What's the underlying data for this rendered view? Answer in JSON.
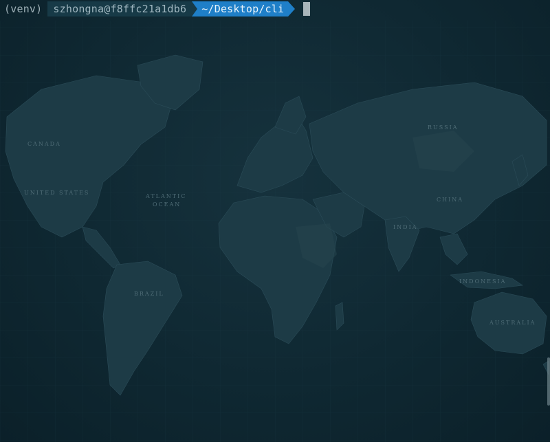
{
  "prompt": {
    "venv": "(venv)",
    "user_host": "szhongna@f8ffc21a1db6",
    "path": "~/Desktop/cli"
  },
  "map_labels": {
    "canada": "CANADA",
    "united_states": "UNITED STATES",
    "atlantic": "ATLANTIC",
    "ocean": "OCEAN",
    "russia": "RUSSIA",
    "china": "CHINA",
    "brazil": "BRAZIL",
    "australia": "AUSTRALIA",
    "indonesia": "INDONESIA",
    "india": "INDIA"
  },
  "colors": {
    "background": "#0d2530",
    "land": "#1b3843",
    "accent_path": "#1f7fc8"
  }
}
